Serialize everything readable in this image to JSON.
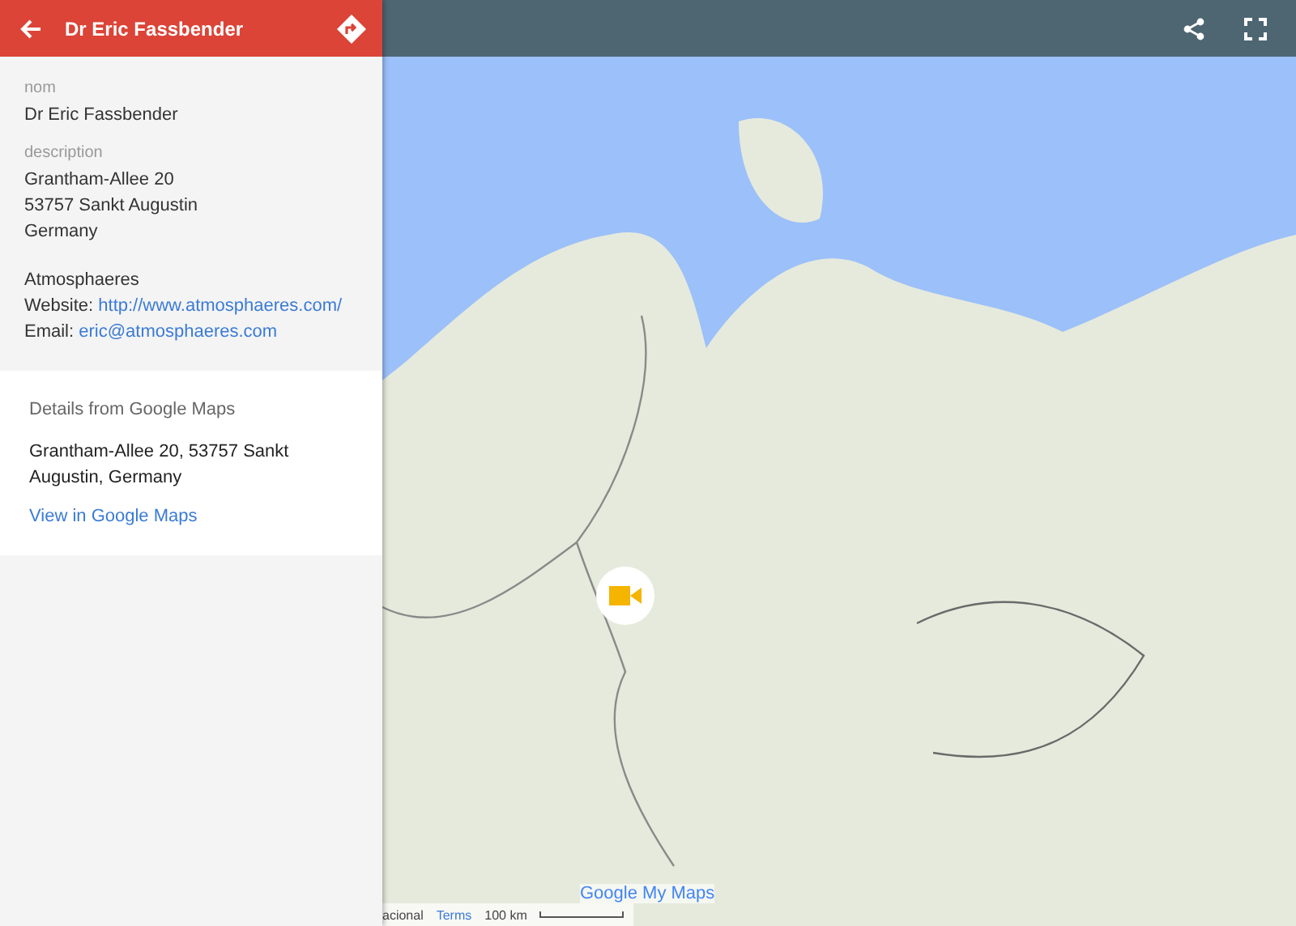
{
  "header": {
    "title": "Dr Eric Fassbender"
  },
  "details": {
    "fields": [
      {
        "label": "nom",
        "lines": [
          "Dr Eric Fassbender"
        ]
      },
      {
        "label": "description",
        "lines": [
          "Grantham-Allee 20",
          "53757 Sankt Augustin",
          "Germany"
        ]
      }
    ],
    "org": "Atmosphaeres",
    "website": {
      "label": "Website:",
      "link": "http://www.atmosphaeres.com/"
    },
    "email": {
      "label": "Email:",
      "link": "eric@atmosphaeres.com"
    }
  },
  "google_details": {
    "heading": "Details from Google Maps",
    "address": "Grantham-Allee 20, 53757 Sankt Augustin, Germany",
    "link": "View in Google Maps"
  },
  "map_footer": {
    "logo": "Google My Maps",
    "attribution": "acional",
    "terms": "Terms",
    "scale": "100 km"
  }
}
